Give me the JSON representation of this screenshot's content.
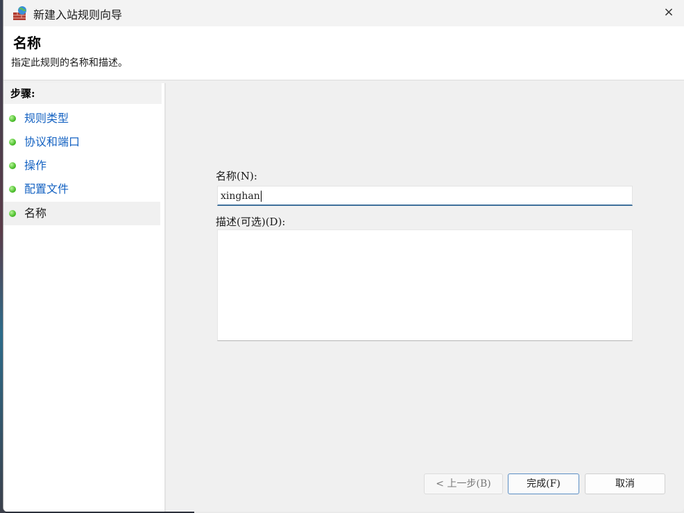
{
  "window": {
    "title": "新建入站规则向导",
    "close_glyph": "×"
  },
  "header": {
    "title": "名称",
    "subtitle": "指定此规则的名称和描述。"
  },
  "steps": {
    "heading": "步骤:",
    "items": [
      {
        "label": "规则类型",
        "active": false
      },
      {
        "label": "协议和端口",
        "active": false
      },
      {
        "label": "操作",
        "active": false
      },
      {
        "label": "配置文件",
        "active": false
      },
      {
        "label": "名称",
        "active": true
      }
    ]
  },
  "form": {
    "name_label": "名称(N):",
    "name_value": "xinghan",
    "desc_label": "描述(可选)(D):",
    "desc_value": ""
  },
  "buttons": {
    "back": "< 上一步(B)",
    "finish": "完成(F)",
    "cancel": "取消"
  },
  "icons": {
    "app": "firewall-globe-icon",
    "close": "close-icon",
    "step_bullet": "green-dot-icon"
  }
}
